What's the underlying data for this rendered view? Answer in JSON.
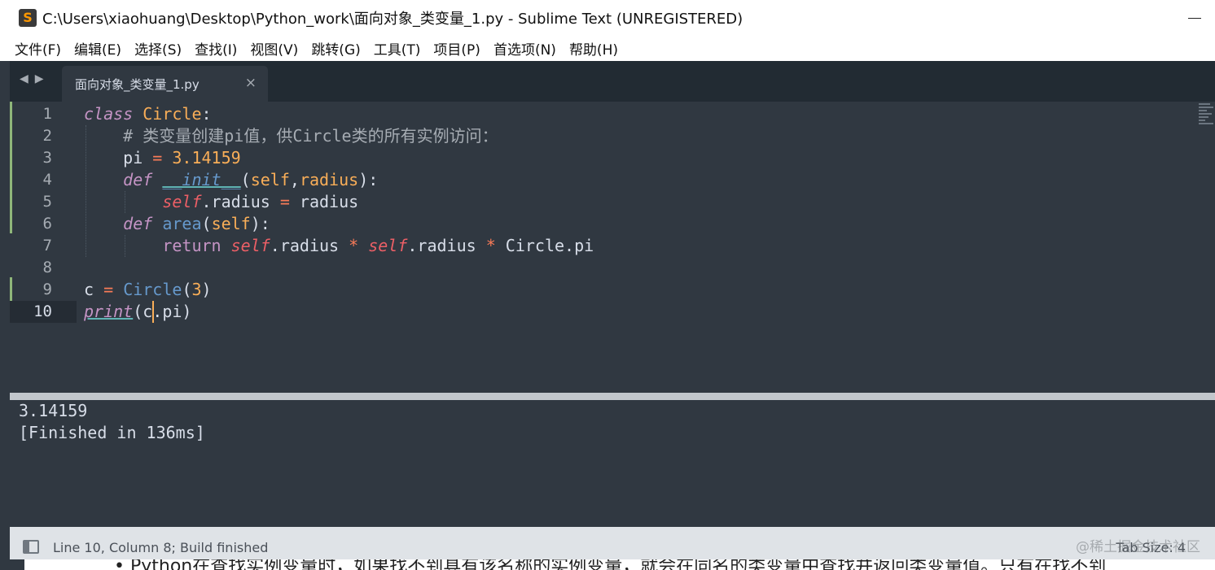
{
  "window": {
    "title": "C:\\Users\\xiaohuang\\Desktop\\Python_work\\面向对象_类变量_1.py - Sublime Text (UNREGISTERED)",
    "app_icon": "sublime-icon"
  },
  "menu": [
    "文件(F)",
    "编辑(E)",
    "选择(S)",
    "查找(I)",
    "视图(V)",
    "跳转(G)",
    "工具(T)",
    "项目(P)",
    "首选项(N)",
    "帮助(H)"
  ],
  "tab": {
    "nav_prev": "◀",
    "nav_next": "▶",
    "filename": "面向对象_类变量_1.py",
    "close": "×"
  },
  "editor": {
    "line_numbers": [
      "1",
      "2",
      "3",
      "4",
      "5",
      "6",
      "7",
      "8",
      "9",
      "10"
    ],
    "active_line": 10,
    "cursor": {
      "line": 10,
      "column": 8
    },
    "code_lines": [
      "class Circle:",
      "    # 类变量创建pi值，供Circle类的所有实例访问：",
      "    pi = 3.14159",
      "    def __init__(self,radius):",
      "        self.radius = radius",
      "    def area(self):",
      "        return self.radius * self.radius * Circle.pi",
      "",
      "c = Circle(3)",
      "print(c.pi)"
    ]
  },
  "output": {
    "lines": [
      "3.14159",
      "[Finished in 136ms]"
    ]
  },
  "status": {
    "left_text": "Line 10, Column 8; Build finished",
    "tab_size": "Tab Size: 4",
    "watermark": "@稀土掘金技术社区"
  },
  "underlay": {
    "text": "• Python在查找实例变量时，如果找不到具有该名称的实例变量，就会在同名的类变量中查找并返回类变量值。只有在找不到"
  },
  "colors": {
    "editor_bg": "#303841",
    "keyword": "#c594c5",
    "class_name": "#f9ae58",
    "operator": "#f97b58",
    "function": "#6699cc",
    "self": "#ec5f66",
    "comment": "#a6acb3"
  }
}
